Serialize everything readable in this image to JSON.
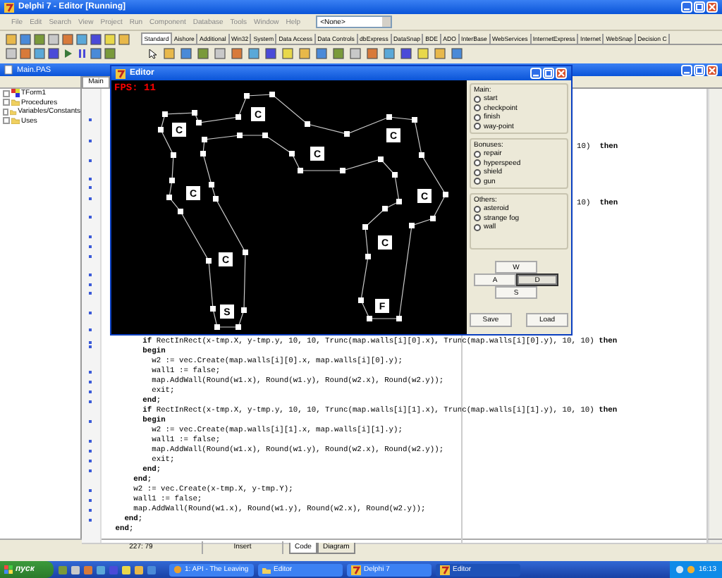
{
  "ide_window": {
    "title": "Delphi 7 - Editor [Running]"
  },
  "menu": [
    "File",
    "Edit",
    "Search",
    "View",
    "Project",
    "Run",
    "Component",
    "Database",
    "Tools",
    "Window",
    "Help"
  ],
  "component_combo": {
    "value": "<None>"
  },
  "palette_tabs": [
    {
      "label": "Standard",
      "selected": true
    },
    {
      "label": "Aishore",
      "selected": false
    },
    {
      "label": "Additional",
      "selected": false
    },
    {
      "label": "Win32",
      "selected": false
    },
    {
      "label": "System",
      "selected": false
    },
    {
      "label": "Data Access",
      "selected": false
    },
    {
      "label": "Data Controls",
      "selected": false
    },
    {
      "label": "dbExpress",
      "selected": false
    },
    {
      "label": "DataSnap",
      "selected": false
    },
    {
      "label": "BDE",
      "selected": false
    },
    {
      "label": "ADO",
      "selected": false
    },
    {
      "label": "InterBase",
      "selected": false
    },
    {
      "label": "WebServices",
      "selected": false
    },
    {
      "label": "InternetExpress",
      "selected": false
    },
    {
      "label": "Internet",
      "selected": false
    },
    {
      "label": "WebSnap",
      "selected": false
    },
    {
      "label": "Decision C",
      "selected": false
    }
  ],
  "unit_window": {
    "title": "Main.PAS"
  },
  "explorer_tree": [
    {
      "label": "TForm1",
      "kind": "form"
    },
    {
      "label": "Procedures",
      "kind": "folder"
    },
    {
      "label": "Variables/Constants",
      "kind": "folder"
    },
    {
      "label": "Uses",
      "kind": "folder"
    }
  ],
  "editor_tabs": [
    {
      "label": "Main",
      "selected": true
    }
  ],
  "code": {
    "tails": [
      "10)  **then**",
      "10)  **then**"
    ],
    "lines": [
      {
        "text": "         **if** RectInRect(x-tmp.X, y-tmp.y, 10, 10, Trunc(map.walls[i][0].x), Trunc(map.walls[i][0].y), 10, 10) **then**"
      },
      {
        "text": "         **begin**"
      },
      {
        "text": "           w2 := vec.Create(map.walls[i][0].x, map.walls[i][0].y);"
      },
      {
        "text": "           wall1 := false;"
      },
      {
        "text": "           map.AddWall(Round(w1.x), Round(w1.y), Round(w2.x), Round(w2.y));"
      },
      {
        "text": "           exit;"
      },
      {
        "text": "         **end**;"
      },
      {
        "text": "         **if** RectInRect(x-tmp.X, y-tmp.y, 10, 10, Trunc(map.walls[i][1].x), Trunc(map.walls[i][1].y), 10, 10) **then**"
      },
      {
        "text": "         **begin**"
      },
      {
        "text": "           w2 := vec.Create(map.walls[i][1].x, map.walls[i][1].y);"
      },
      {
        "text": "           wall1 := false;"
      },
      {
        "text": "           map.AddWall(Round(w1.x), Round(w1.y), Round(w2.x), Round(w2.y));"
      },
      {
        "text": "           exit;"
      },
      {
        "text": "         **end**;"
      },
      {
        "text": "       **end**;"
      },
      {
        "text": "       w2 := vec.Create(x-tmp.X, y-tmp.Y);"
      },
      {
        "text": "       wall1 := false;"
      },
      {
        "text": "       map.AddWall(Round(w1.x), Round(w1.y), Round(w2.x), Round(w2.y));"
      },
      {
        "text": "     **end**;"
      },
      {
        "text": "   **end**;"
      }
    ]
  },
  "status_bar": {
    "position": "227: 79",
    "mode": "Insert",
    "tabs": [
      {
        "label": "Code",
        "selected": true
      },
      {
        "label": "Diagram",
        "selected": false
      }
    ]
  },
  "app_window": {
    "title": "Editor",
    "fps": "FPS:  11",
    "markers": [
      "C",
      "C",
      "C",
      "C",
      "C",
      "C",
      "C",
      "C",
      "F",
      "S"
    ],
    "groups": [
      {
        "title": "Main:",
        "options": [
          {
            "label": "start",
            "selected": false
          },
          {
            "label": "checkpoint",
            "selected": false
          },
          {
            "label": "finish",
            "selected": false
          },
          {
            "label": "way-point",
            "selected": false
          }
        ]
      },
      {
        "title": "Bonuses:",
        "options": [
          {
            "label": "repair",
            "selected": false
          },
          {
            "label": "hyperspeed",
            "selected": false
          },
          {
            "label": "shield",
            "selected": false
          },
          {
            "label": "gun",
            "selected": false
          }
        ]
      },
      {
        "title": "Others:",
        "options": [
          {
            "label": "asteroid",
            "selected": false
          },
          {
            "label": "strange fog",
            "selected": false
          },
          {
            "label": "wall",
            "selected": false
          }
        ]
      }
    ],
    "direction_buttons": [
      {
        "label": "W",
        "pressed": false
      },
      {
        "label": "A",
        "pressed": false
      },
      {
        "label": "D",
        "pressed": true
      },
      {
        "label": "S",
        "pressed": false
      }
    ],
    "buttons": [
      "Save",
      "Load"
    ]
  },
  "taskbar": {
    "start": "пуск",
    "tasks": [
      {
        "label": "1: API - The Leaving",
        "kind": "app",
        "active": false
      },
      {
        "label": "Editor",
        "kind": "folder",
        "active": false
      },
      {
        "label": "Delphi 7",
        "kind": "delphi",
        "active": false
      },
      {
        "label": "Editor",
        "kind": "delphi",
        "active": true
      }
    ],
    "clock": "16:13"
  }
}
